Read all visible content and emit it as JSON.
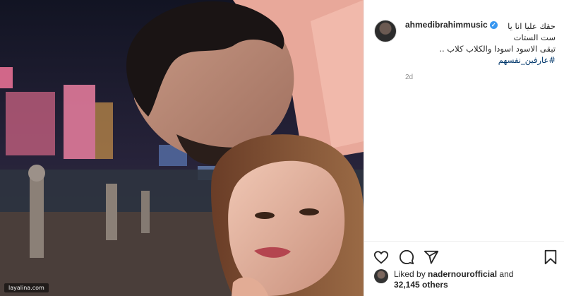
{
  "post": {
    "username": "ahmedibrahimmusic",
    "verified_icon": "verified-badge-icon",
    "caption_lines": [
      "حقك عليا انا يا",
      "ست الستات",
      "تبقى الاسود اسودا والكلاب كلاب .."
    ],
    "hashtag": "#عارفين_نفسهم",
    "time": "2d",
    "liked_by_prefix": "Liked by",
    "liked_by_user": "nadernourofficial",
    "liked_by_and": "and",
    "others_count": "32,145 others",
    "watermark": "layalina.com"
  },
  "icons": {
    "like": "heart-icon",
    "comment": "comment-icon",
    "share": "share-icon",
    "save": "bookmark-icon"
  },
  "colors": {
    "link": "#00376b",
    "verified": "#3897f0",
    "muted": "#8e8e8e"
  }
}
